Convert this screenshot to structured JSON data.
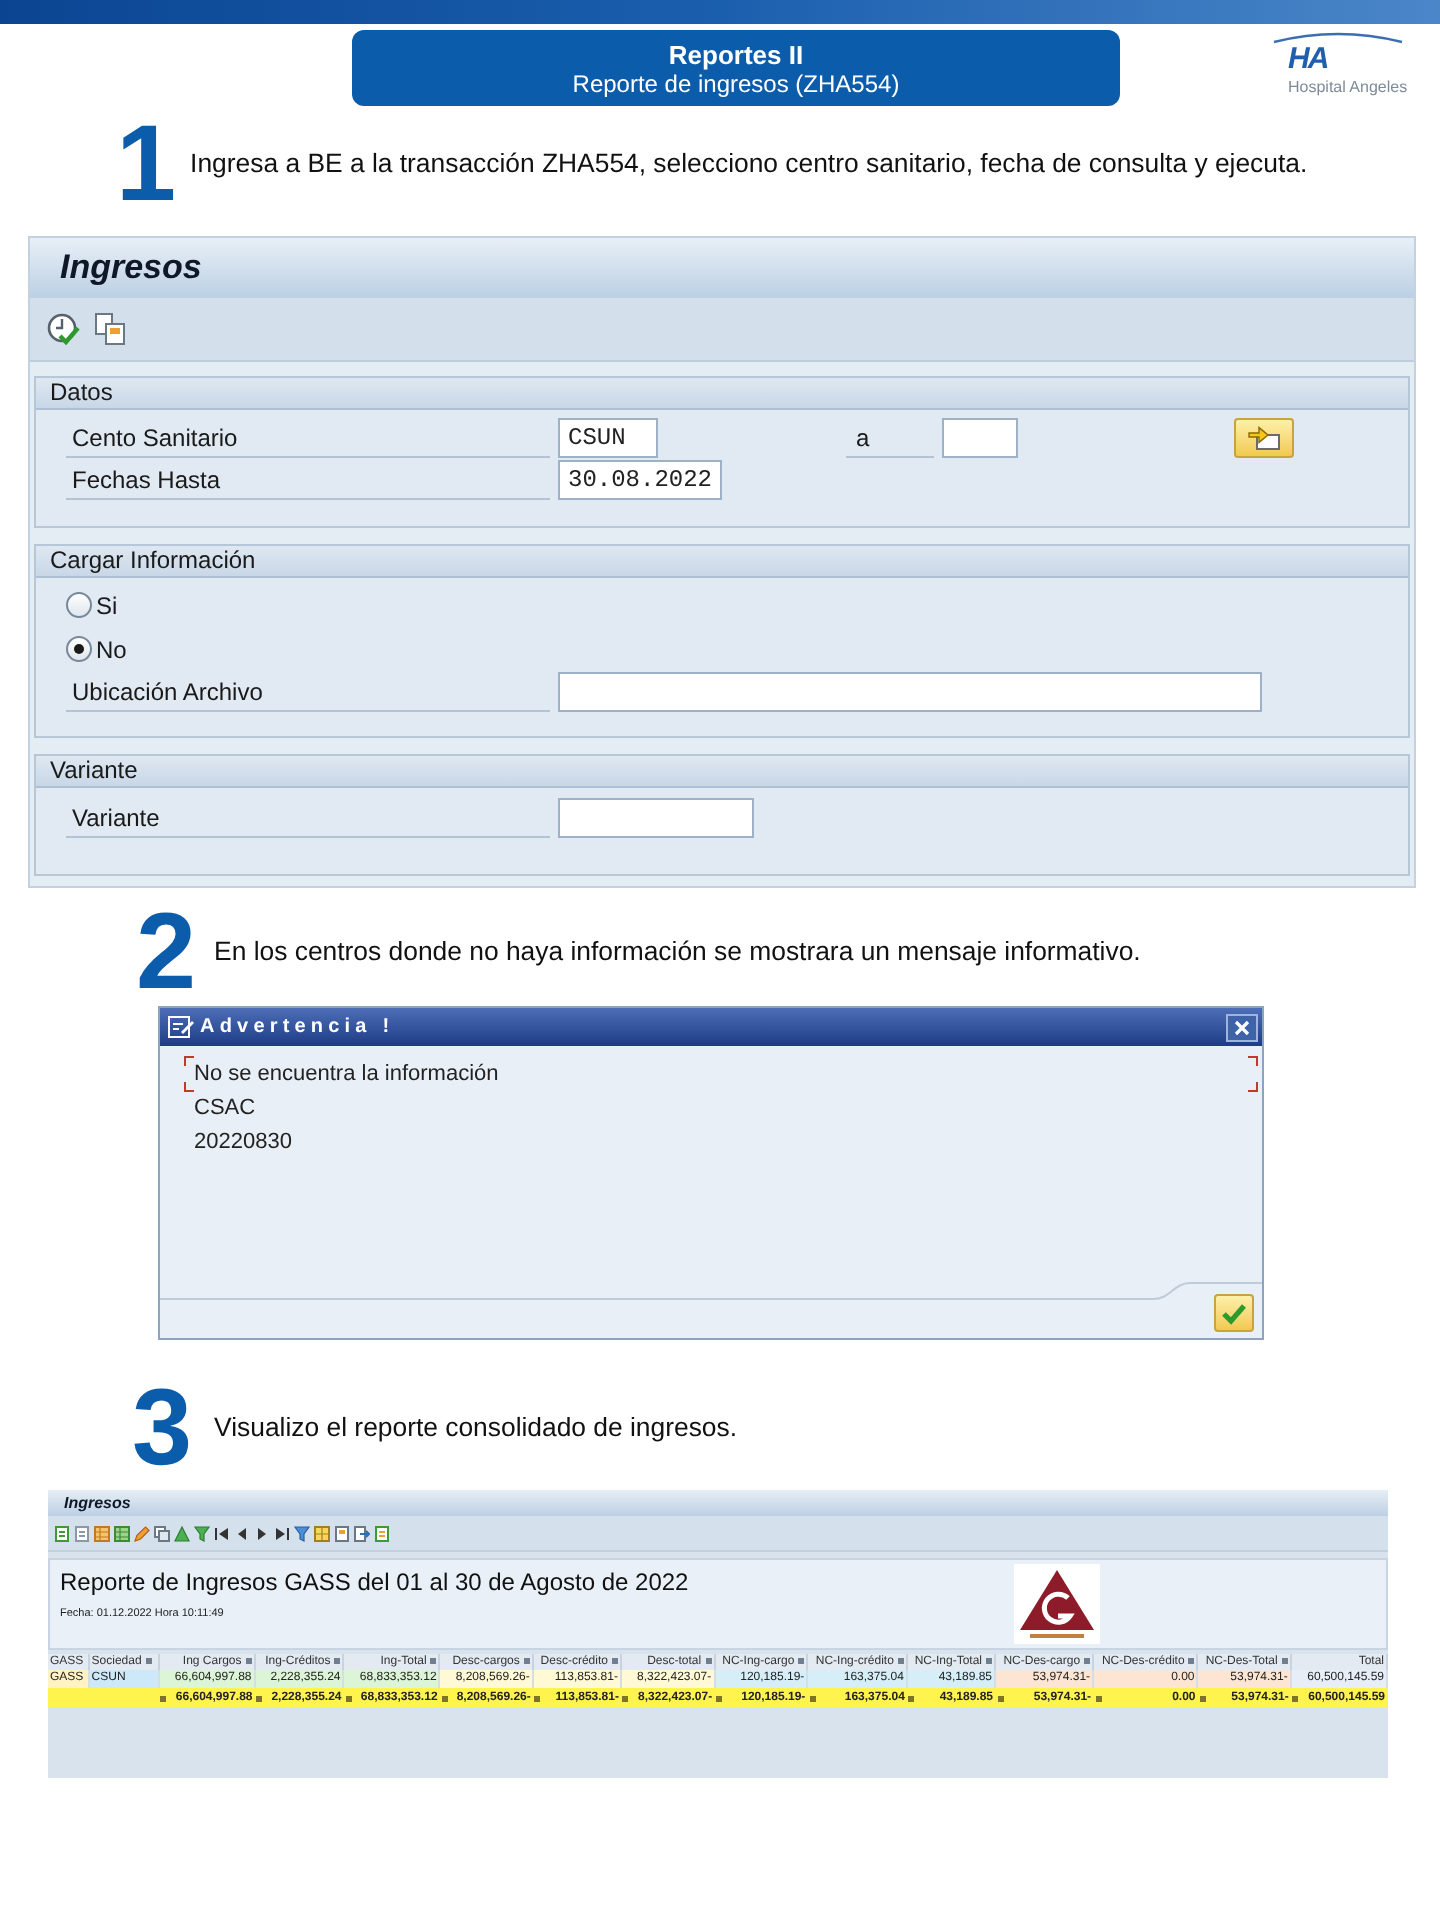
{
  "banner": {
    "title": "Reportes II",
    "subtitle": "Reporte de ingresos (ZHA554)"
  },
  "logo": {
    "mark": "HA",
    "name": "Hospital Angeles"
  },
  "steps": [
    {
      "number": "1",
      "text": "Ingresa a BE a la transacción ZHA554, selecciono centro sanitario, fecha de consulta y ejecuta.",
      "screen": {
        "kind": "selection_screen",
        "title": "Ingresos",
        "sections": [
          {
            "title": "Datos",
            "rows": [
              {
                "kind": "range",
                "label": "Cento Sanitario",
                "value": "CSUN",
                "to_label": "a"
              },
              {
                "kind": "date",
                "label": "Fechas Hasta",
                "value": "30.08.2022"
              }
            ]
          },
          {
            "title": "Cargar Información",
            "rows": [
              {
                "kind": "radio",
                "label": "Si",
                "selected": false
              },
              {
                "kind": "radio",
                "label": "No",
                "selected": true
              },
              {
                "kind": "file",
                "label": "Ubicación Archivo"
              }
            ]
          },
          {
            "title": "Variante",
            "rows": [
              {
                "kind": "text",
                "label": "Variante"
              }
            ]
          }
        ]
      }
    },
    {
      "number": "2",
      "text": "En los centros donde no haya información se mostrara un mensaje informativo.",
      "screen": {
        "kind": "message_dialog",
        "title": "Advertencia !",
        "lines": [
          "No se encuentra la información",
          "CSAC",
          "20220830"
        ]
      }
    },
    {
      "number": "3",
      "text": "Visualizo el reporte consolidado de ingresos.",
      "screen": {
        "kind": "report",
        "title": "Ingresos",
        "heading": "Reporte de Ingresos GASS del 01 al 30 de Agosto de 2022",
        "subheading": "Fecha: 01.12.2022 Hora 10:11:49",
        "columns": [
          {
            "label": "GASS",
            "color": "#fff3c4"
          },
          {
            "label": "Sociedad",
            "color": "#cde9f9"
          },
          {
            "label": "Ing Cargos",
            "color": "#dcf5d6"
          },
          {
            "label": "Ing-Créditos",
            "color": "#dcf5d6"
          },
          {
            "label": "Ing-Total",
            "color": "#dcf5d6"
          },
          {
            "label": "Desc-cargos",
            "color": "#fff9d6"
          },
          {
            "label": "Desc-crédito",
            "color": "#fff9d6"
          },
          {
            "label": "Desc-total",
            "color": "#fff9d6"
          },
          {
            "label": "NC-Ing-cargo",
            "color": "#d5eef8"
          },
          {
            "label": "NC-Ing-crédito",
            "color": "#d5eef8"
          },
          {
            "label": "NC-Ing-Total",
            "color": "#d5eef8"
          },
          {
            "label": "NC-Des-cargo",
            "color": "#fce6d3"
          },
          {
            "label": "NC-Des-crédito",
            "color": "#fce6d3"
          },
          {
            "label": "NC-Des-Total",
            "color": "#fce6d3"
          },
          {
            "label": "Total",
            "color": "#e7eef8"
          }
        ],
        "rows": [
          {
            "cells": [
              "GASS",
              "CSUN",
              "66,604,997.88",
              "2,228,355.24",
              "68,833,353.12",
              "8,208,569.26-",
              "113,853.81-",
              "8,322,423.07-",
              "120,185.19-",
              "163,375.04",
              "43,189.85",
              "53,974.31-",
              "0.00",
              "53,974.31-",
              "60,500,145.59"
            ]
          }
        ],
        "totals": [
          "66,604,997.88",
          "2,228,355.24",
          "68,833,353.12",
          "8,208,569.26-",
          "113,853.81-",
          "8,322,423.07-",
          "120,185.19-",
          "163,375.04",
          "43,189.85",
          "53,974.31-",
          "0.00",
          "53,974.31-",
          "60,500,145.59"
        ]
      }
    }
  ]
}
